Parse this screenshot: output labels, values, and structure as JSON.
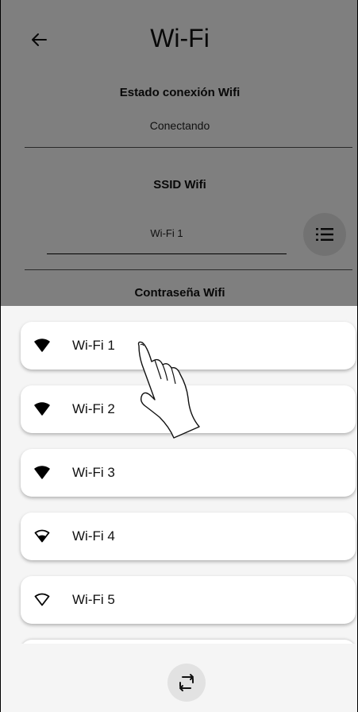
{
  "header": {
    "title": "Wi-Fi",
    "back_icon": "arrow-left-icon"
  },
  "connection": {
    "label": "Estado conexión Wifi",
    "status": "Conectando"
  },
  "ssid": {
    "label": "SSID Wifi",
    "value": "Wi-Fi 1",
    "list_icon": "list-icon"
  },
  "password": {
    "label": "Contraseña Wifi"
  },
  "networks": [
    {
      "name": "Wi-Fi 1",
      "icon": "wifi-full-icon"
    },
    {
      "name": "Wi-Fi 2",
      "icon": "wifi-full-icon"
    },
    {
      "name": "Wi-Fi 3",
      "icon": "wifi-full-icon"
    },
    {
      "name": "Wi-Fi 4",
      "icon": "wifi-medium-icon"
    },
    {
      "name": "Wi-Fi 5",
      "icon": "wifi-empty-icon"
    }
  ],
  "refresh": {
    "icon": "refresh-icon"
  },
  "gesture": {
    "icon": "tap-hand-icon"
  }
}
